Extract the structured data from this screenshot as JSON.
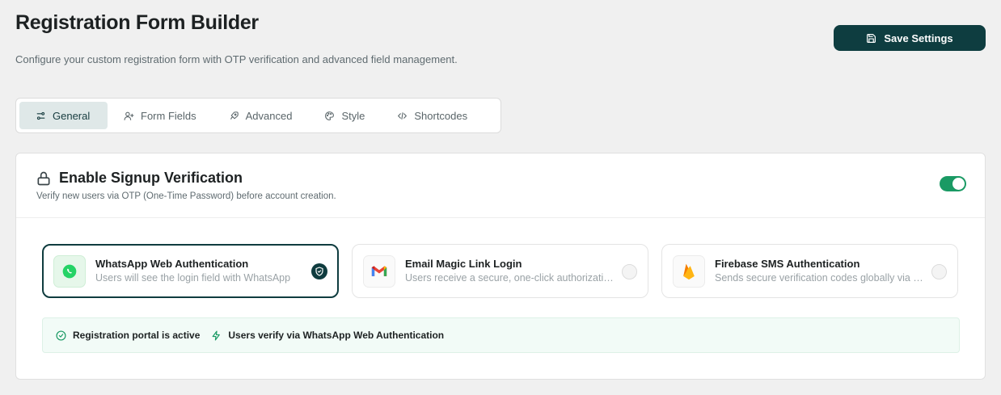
{
  "header": {
    "title": "Registration Form Builder",
    "subtitle": "Configure your custom registration form with OTP verification and advanced field management.",
    "save_label": "Save Settings"
  },
  "tabs": [
    {
      "label": "General",
      "icon": "sliders-icon",
      "active": true
    },
    {
      "label": "Form Fields",
      "icon": "user-plus-icon",
      "active": false
    },
    {
      "label": "Advanced",
      "icon": "rocket-icon",
      "active": false
    },
    {
      "label": "Style",
      "icon": "palette-icon",
      "active": false
    },
    {
      "label": "Shortcodes",
      "icon": "code-icon",
      "active": false
    }
  ],
  "verification": {
    "title": "Enable Signup Verification",
    "description": "Verify new users via OTP (One-Time Password) before account creation.",
    "enabled": true,
    "toggle_color": "#1a9a64",
    "methods": [
      {
        "title": "WhatsApp Web Authentication",
        "description": "Users will see the login field with WhatsApp",
        "icon": "whatsapp-icon",
        "selected": true
      },
      {
        "title": "Email Magic Link Login",
        "description": "Users receive a secure, one-click authorization link",
        "icon": "gmail-icon",
        "selected": false
      },
      {
        "title": "Firebase SMS Authentication",
        "description": "Sends secure verification codes globally via SMS",
        "icon": "firebase-icon",
        "selected": false
      }
    ]
  },
  "status": {
    "active_text": "Registration portal is active",
    "verify_text": "Users verify via WhatsApp Web Authentication"
  },
  "colors": {
    "brand": "#0e3d40",
    "success": "#1a9a64"
  }
}
